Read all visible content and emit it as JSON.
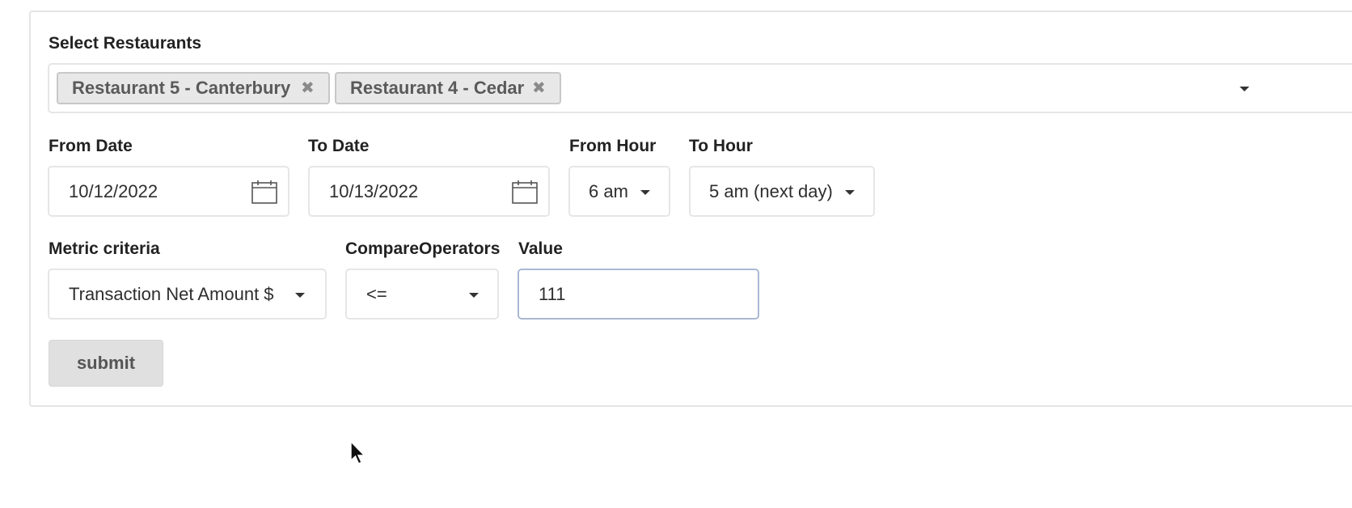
{
  "restaurants": {
    "label": "Select Restaurants",
    "selected": [
      {
        "label": "Restaurant 5 - Canterbury",
        "remove_icon": "close-icon"
      },
      {
        "label": "Restaurant 4 - Cedar",
        "remove_icon": "close-icon"
      }
    ],
    "dropdown_icon": "caret-down-icon"
  },
  "from_date": {
    "label": "From Date",
    "value": "10/12/2022",
    "icon": "calendar-icon"
  },
  "to_date": {
    "label": "To Date",
    "value": "10/13/2022",
    "icon": "calendar-icon"
  },
  "from_hour": {
    "label": "From Hour",
    "value": "6 am",
    "icon": "caret-down-icon"
  },
  "to_hour": {
    "label": "To Hour",
    "value": "5 am (next day)",
    "icon": "caret-down-icon"
  },
  "metric": {
    "label": "Metric criteria",
    "value": "Transaction Net Amount $",
    "icon": "caret-down-icon"
  },
  "compare": {
    "label": "CompareOperators",
    "value": "<=",
    "icon": "caret-down-icon"
  },
  "value_field": {
    "label": "Value",
    "value": "111"
  },
  "submit": {
    "label": "submit"
  },
  "colors": {
    "chip_bg": "#e8e8e8",
    "focus_border": "#a9b9d3",
    "submit_bg": "#e0e0e0"
  }
}
